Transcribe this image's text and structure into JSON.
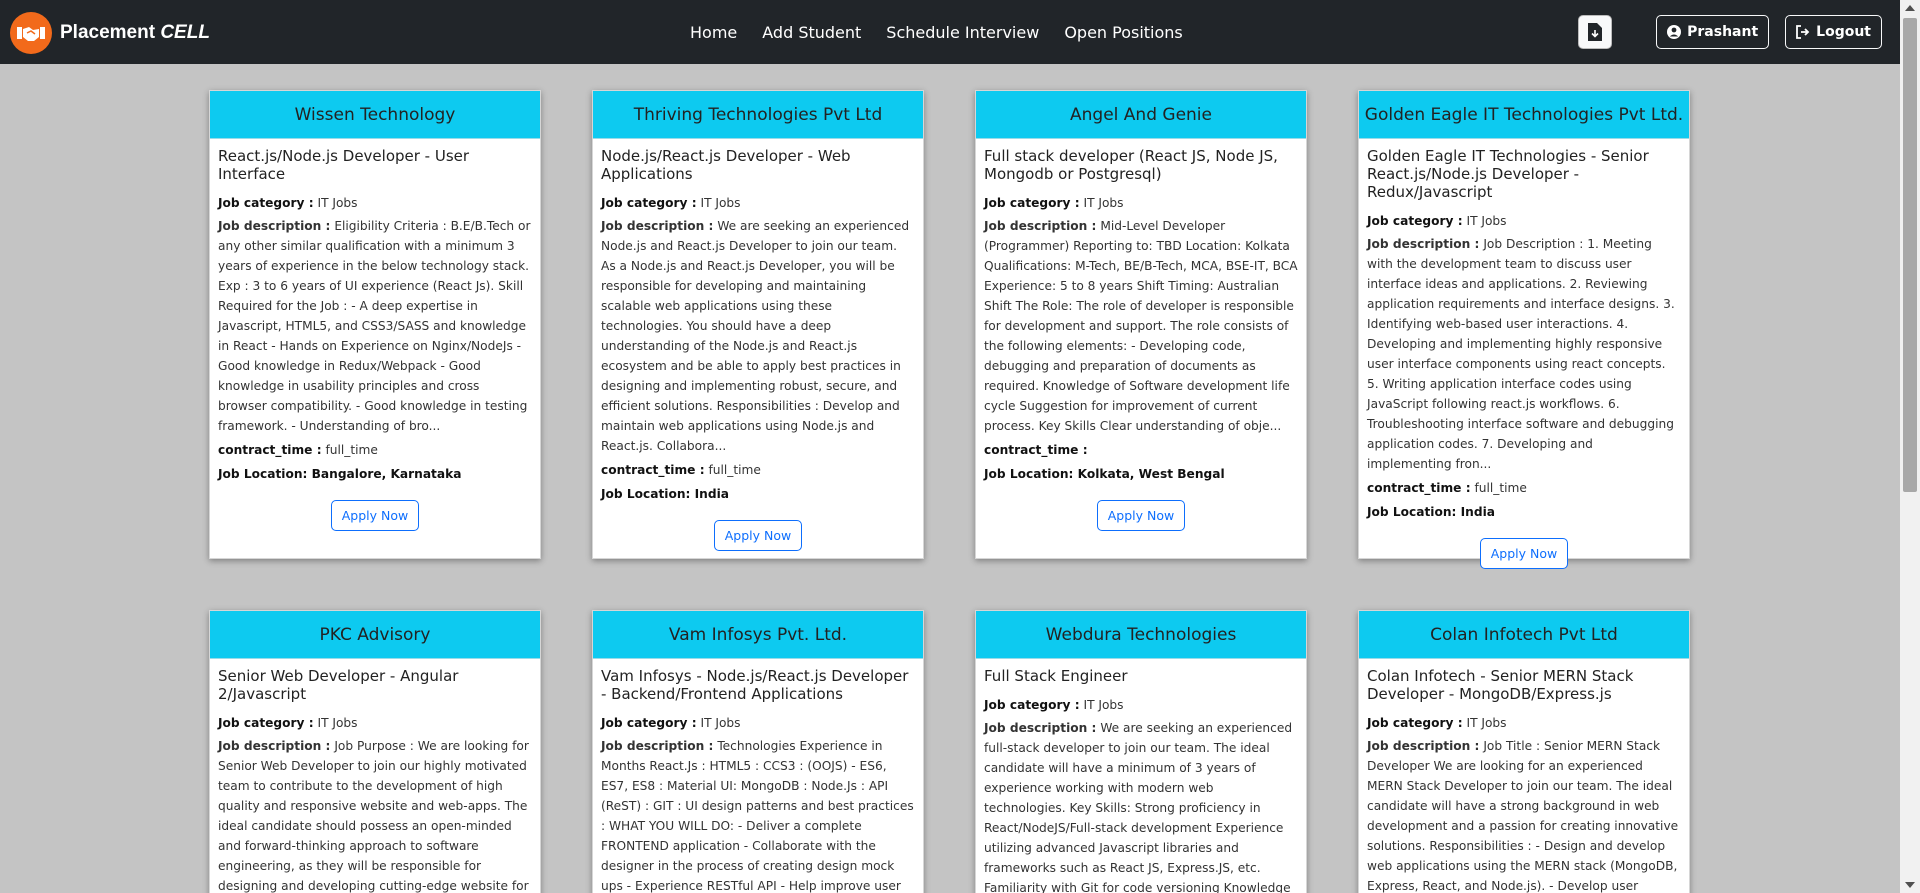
{
  "brand": {
    "name_prefix": "Placement",
    "name_suffix": "CELL"
  },
  "nav": [
    {
      "label": "Home"
    },
    {
      "label": "Add Student"
    },
    {
      "label": "Schedule Interview"
    },
    {
      "label": "Open Positions"
    }
  ],
  "user": {
    "name": "Prashant"
  },
  "logout_label": "Logout",
  "labels": {
    "category": "Job category :",
    "description": "Job description :",
    "contract": "contract_time :",
    "location": "Job Location:",
    "apply": "Apply Now"
  },
  "jobs": [
    {
      "company": "Wissen Technology",
      "title": "React.js/Node.js Developer - User Interface",
      "category": "IT Jobs",
      "description": "Eligibility Criteria : B.E/B.Tech or any other similar qualification with a minimum 3 years of experience in the below technology stack. Exp : 3 to 6 years of UI experience (React Js). Skill Required for the Job : - A deep expertise in Javascript, HTML5, and CSS3/SASS and knowledge in React - Hands on Experience on Nginx/NodeJs - Good knowledge in Redux/Webpack - Good knowledge in usability principles and cross browser compatibility. - Good knowledge in testing framework. - Understanding of bro...",
      "contract_time": "full_time",
      "location": "Bangalore, Karnataka"
    },
    {
      "company": "Thriving Technologies Pvt Ltd",
      "title": "Node.js/React.js Developer - Web Applications",
      "category": "IT Jobs",
      "description": "We are seeking an experienced Node.js and React.js Developer to join our team. As a Node.js and React.js Developer, you will be responsible for developing and maintaining scalable web applications using these technologies. You should have a deep understanding of the Node.js and React.js ecosystem and be able to apply best practices in designing and implementing robust, secure, and efficient solutions. Responsibilities : Develop and maintain web applications using Node.js and React.js. Collabora...",
      "contract_time": "full_time",
      "location": "India"
    },
    {
      "company": "Angel And Genie",
      "title": "Full stack developer (React JS, Node JS, Mongodb or Postgresql)",
      "category": "IT Jobs",
      "description": "Mid-Level Developer (Programmer) Reporting to: TBD Location: Kolkata Qualifications: M-Tech, BE/B-Tech, MCA, BSE-IT, BCA Experience: 5 to 8 years Shift Timing: Australian Shift The Role: The role of developer is responsible for development and support. The role consists of the following elements: - Developing code, debugging and preparation of documents as required. Knowledge of Software development life cycle Suggestion for improvement of current process. Key Skills Clear understanding of obje...",
      "contract_time": "",
      "location": "Kolkata, West Bengal"
    },
    {
      "company": "Golden Eagle IT Technologies Pvt Ltd.",
      "title": "Golden Eagle IT Technologies - Senior React.js/Node.js Developer - Redux/Javascript",
      "category": "IT Jobs",
      "description": "Job Description : 1. Meeting with the development team to discuss user interface ideas and applications. 2. Reviewing application requirements and interface designs. 3. Identifying web-based user interactions. 4. Developing and implementing highly responsive user interface components using react concepts. 5. Writing application interface codes using JavaScript following react.js workflows. 6. Troubleshooting interface software and debugging application codes. 7. Developing and implementing fron...",
      "contract_time": "full_time",
      "location": "India"
    },
    {
      "company": "PKC Advisory",
      "title": "Senior Web Developer - Angular 2/Javascript",
      "category": "IT Jobs",
      "description": "Job Purpose : We are looking for Senior Web Developer to join our highly motivated team to contribute to the development of high quality and responsive website and web-apps. The ideal candidate should possess an open-minded and forward-thinking approach to software engineering, as they will be responsible for designing and developing cutting-edge website for browsers running various operating systems. Key",
      "contract_time": "",
      "location": ""
    },
    {
      "company": "Vam Infosys Pvt. Ltd.",
      "title": "Vam Infosys - Node.js/React.js Developer - Backend/Frontend Applications",
      "category": "IT Jobs",
      "description": "Technologies Experience in Months React.Js : HTML5 : CCS3 : (OOJS) - ES6, ES7, ES8 : Material UI: MongoDB : Node.Js : API (ReST) : GIT : UI design patterns and best practices : WHAT YOU WILL DO: - Deliver a complete FRONTEND application - Collaborate with the designer in the process of creating design mock ups - Experience RESTful API - Help improve user experience and performance of",
      "contract_time": "",
      "location": ""
    },
    {
      "company": "Webdura Technologies",
      "title": "Full Stack Engineer",
      "category": "IT Jobs",
      "description": "We are seeking an experienced full-stack developer to join our team. The ideal candidate will have a minimum of 3 years of experience working with modern web technologies. Key Skills: Strong proficiency in React/NodeJS/Full-stack development Experience utilizing advanced Javascript libraries and frameworks such as React JS, Express.JS, etc. Familiarity with Git for code versioning Knowledge of building web apps using",
      "contract_time": "",
      "location": ""
    },
    {
      "company": "Colan Infotech Pvt Ltd",
      "title": "Colan Infotech - Senior MERN Stack Developer - MongoDB/Express.js",
      "category": "IT Jobs",
      "description": "Job Title : Senior MERN Stack Developer We are looking for an experienced MERN Stack Developer to join our team. The ideal candidate will have a strong background in web development and a passion for creating innovative solutions. Responsibilities : - Design and develop web applications using the MERN stack (MongoDB, Express, React, and Node.js). - Develop user",
      "contract_time": "",
      "location": ""
    }
  ]
}
